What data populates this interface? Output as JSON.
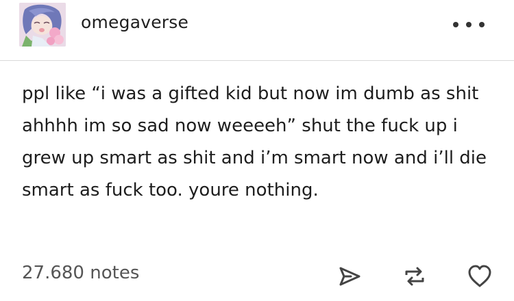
{
  "post": {
    "username": "omegaverse",
    "body": "ppl like “i was a gifted kid but now im dumb as shit ahhhh im so sad now weeeeh” shut the fuck up i grew up smart as shit and i’m smart now and i’ll die smart as fuck too. youre nothing.",
    "notes": "27.680 notes"
  },
  "icons": {
    "avatar": "avatar-illustration",
    "more": "more-horizontal-icon",
    "share": "share-icon",
    "reblog": "reblog-icon",
    "like": "heart-icon"
  },
  "colors": {
    "text": "#1d1d1d",
    "icon": "#444444",
    "divider": "#d9d9d9"
  }
}
